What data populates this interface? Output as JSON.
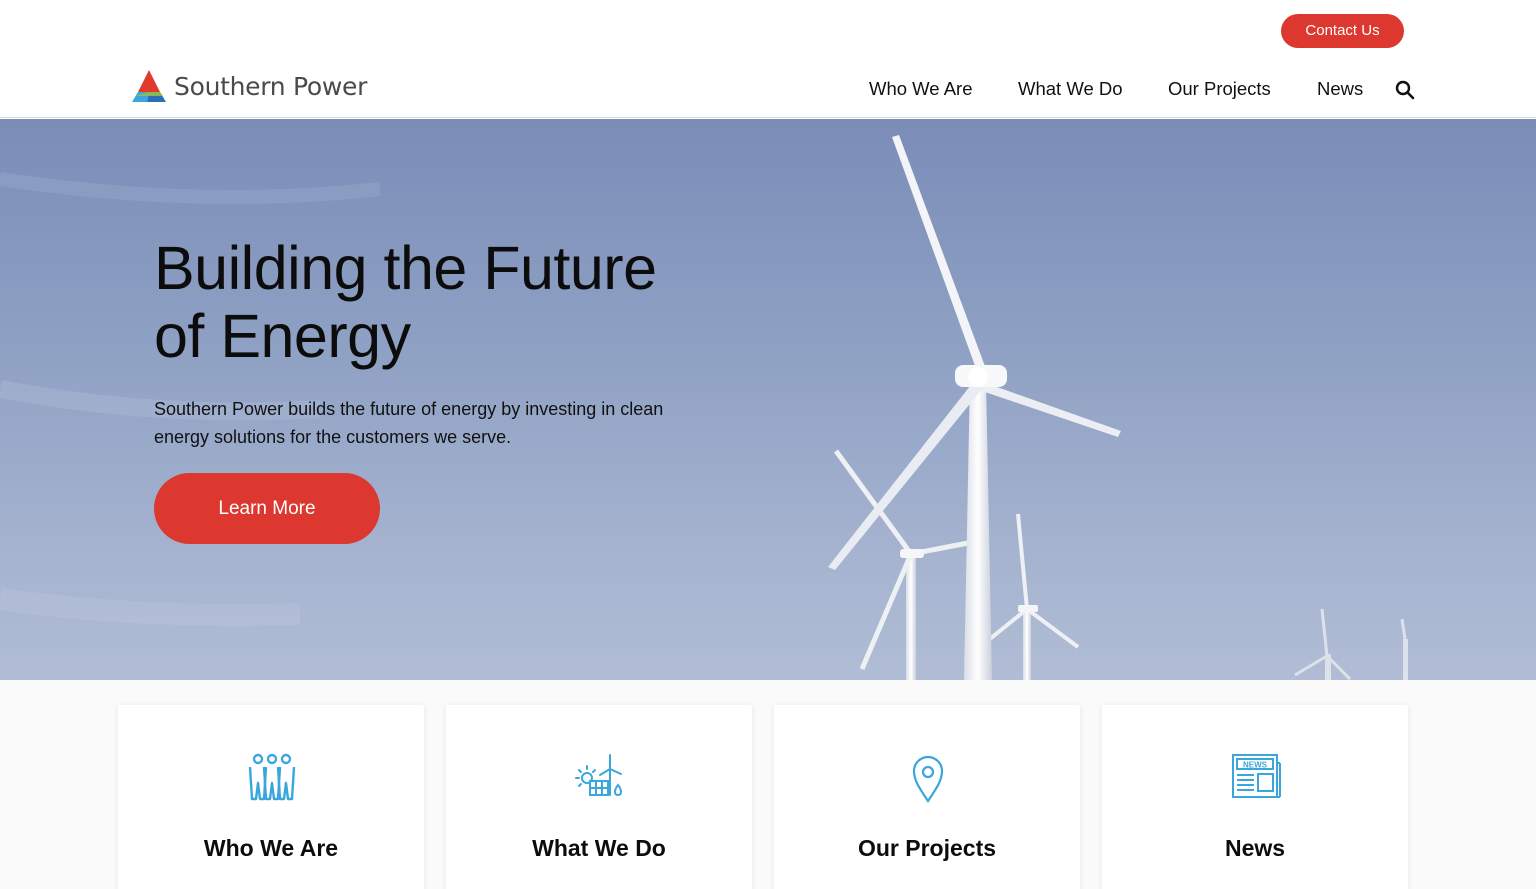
{
  "header": {
    "contact_label": "Contact Us",
    "logo_text": "Southern Power",
    "nav": [
      "Who We Are",
      "What We Do",
      "Our Projects",
      "News"
    ]
  },
  "hero": {
    "title_line1": "Building the Future",
    "title_line2": "of Energy",
    "description": "Southern Power builds the future of energy by investing in clean energy solutions for the customers we serve.",
    "cta_label": "Learn More"
  },
  "cards": [
    {
      "label": "Who We Are",
      "icon": "people-icon"
    },
    {
      "label": "What We Do",
      "icon": "renewable-energy-icon"
    },
    {
      "label": "Our Projects",
      "icon": "map-pin-icon"
    },
    {
      "label": "News",
      "icon": "newspaper-icon"
    }
  ],
  "colors": {
    "accent": "#dc3830",
    "icon": "#3aa7dc",
    "sky": "#8ea0c3"
  }
}
